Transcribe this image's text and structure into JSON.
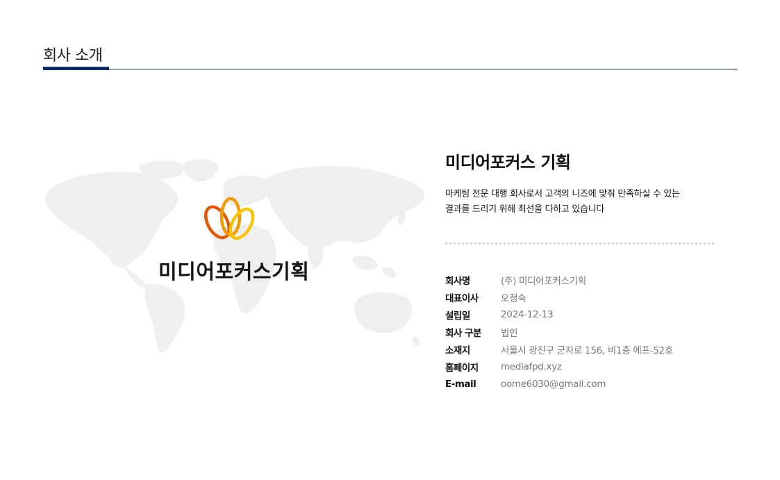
{
  "page": {
    "section_title": "회사 소개"
  },
  "colors": {
    "accent_navy": "#0d2a6b",
    "logo_orange": "#e85d04",
    "logo_yellow": "#f5b800",
    "map_gray": "#efefef"
  },
  "brand": {
    "logo_icon": "petal-logo-icon",
    "logo_text": "미디어포커스기획"
  },
  "company": {
    "title": "미디어포커스 기획",
    "description": "마케팅 전문 대행 회사로서 고객의 니즈에 맞춰 만족하실 수 있는 결과를 드리기 위해 최선을 다하고 있습니다"
  },
  "details": [
    {
      "label": "회사명",
      "value": "(주) 미디어포커스기획"
    },
    {
      "label": "대표이사",
      "value": "오정숙"
    },
    {
      "label": "설립일",
      "value": "2024-12-13"
    },
    {
      "label": "회사 구분",
      "value": "법인"
    },
    {
      "label": "소재지",
      "value": "서울시 광진구 군자로 156, 비1층 에프-52호"
    },
    {
      "label": "홈페이지",
      "value": "mediafpd.xyz"
    },
    {
      "label": "E-mail",
      "value": "oome6030@gmail.com"
    }
  ]
}
